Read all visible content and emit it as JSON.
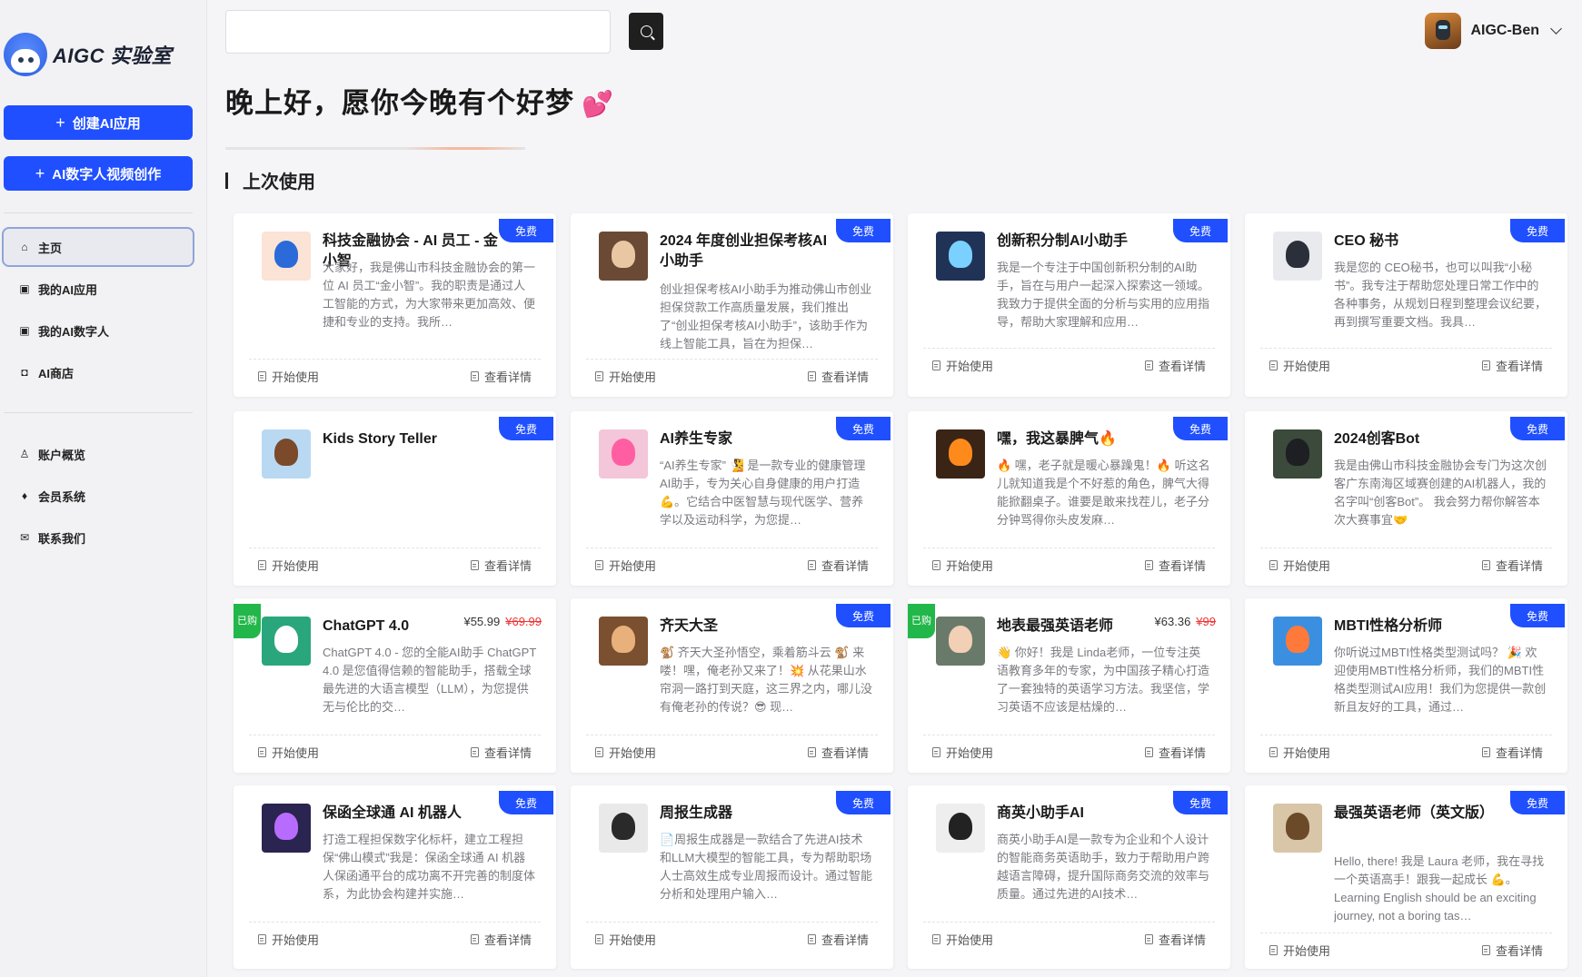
{
  "sidebar": {
    "logo_text": "AIGC 实验室",
    "create_app": "创建AI应用",
    "create_video": "AI数字人视频创作",
    "nav": [
      {
        "label": "主页",
        "icon": "home-icon"
      },
      {
        "label": "我的AI应用",
        "icon": "app-icon"
      },
      {
        "label": "我的AI数字人",
        "icon": "digital-human-icon"
      },
      {
        "label": "AI商店",
        "icon": "store-icon"
      }
    ],
    "nav2": [
      {
        "label": "账户概览",
        "icon": "user-icon"
      },
      {
        "label": "会员系统",
        "icon": "diamond-icon"
      },
      {
        "label": "联系我们",
        "icon": "mail-icon"
      }
    ]
  },
  "header": {
    "search_placeholder": "",
    "user_name": "AIGC-Ben"
  },
  "main": {
    "greeting": "晚上好，愿你今晚有个好梦",
    "greeting_emoji": "💕",
    "section_title": "上次使用"
  },
  "card_actions": {
    "start": "开始使用",
    "detail": "查看详情"
  },
  "cards": [
    {
      "title": "科技金融协会 - AI 员工 - 金小智",
      "badge": "免费",
      "desc": "大家好，我是佛山市科技金融协会的第一位 AI 员工“金小智”。我的职责是通过人工智能的方式，为大家带来更加高效、便捷和专业的支持。我所…"
    },
    {
      "title": "2024 年度创业担保考核AI小助手",
      "badge": "免费",
      "desc": "创业担保考核AI小助手为推动佛山市创业担保贷款工作高质量发展，我们推出了“创业担保考核AI小助手”，该助手作为线上智能工具，旨在为担保…"
    },
    {
      "title": "创新积分制AI小助手",
      "badge": "免费",
      "desc": "我是一个专注于中国创新积分制的AI助手，旨在与用户一起深入探索这一领域。我致力于提供全面的分析与实用的应用指导，帮助大家理解和应用…"
    },
    {
      "title": "CEO 秘书",
      "badge": "免费",
      "desc": "我是您的 CEO秘书，也可以叫我“小秘书”。我专注于帮助您处理日常工作中的各种事务，从规划日程到整理会议纪要，再到撰写重要文档。我具…"
    },
    {
      "title": "Kids Story Teller",
      "badge": "免费",
      "desc": ""
    },
    {
      "title": "AI养生专家",
      "badge": "免费",
      "desc": "“AI养生专家” 🧏 是一款专业的健康管理AI助手，专为关心自身健康的用户打造 💪。它结合中医智慧与现代医学、营养学以及运动科学，为您提…"
    },
    {
      "title": "嘿，我这暴脾气🔥",
      "badge": "免费",
      "desc": "🔥 嘿，老子就是暖心暴躁鬼！🔥 听这名儿就知道我是个不好惹的角色，脾气大得能掀翻桌子。谁要是敢来找茬儿，老子分分钟骂得你头皮发麻…"
    },
    {
      "title": "2024创客Bot",
      "badge": "免费",
      "desc": "我是由佛山市科技金融协会专门为这次创客广东南海区域赛创建的AI机器人，我的名字叫“创客Bot”。 我会努力帮你解答本次大赛事宜🤝"
    },
    {
      "title": "ChatGPT 4.0",
      "badge": "已购",
      "price": "¥55.99",
      "old_price": "¥69.99",
      "desc": "ChatGPT 4.0 - 您的全能AI助手 ChatGPT 4.0 是您值得信赖的智能助手，搭载全球最先进的大语言模型（LLM），为您提供无与伦比的交…"
    },
    {
      "title": "齐天大圣",
      "badge": "免费",
      "desc": "🐒 齐天大圣孙悟空，乘着筋斗云 🐒 来喽！嘿，俺老孙又来了！💥 从花果山水帘洞一路打到天庭，这三界之内，哪儿没有俺老孙的传说？😎 现…"
    },
    {
      "title": "地表最强英语老师",
      "badge": "已购",
      "price": "¥63.36",
      "old_price": "¥99",
      "desc": "👋 你好！我是 Linda老师，一位专注英语教育多年的专家，为中国孩子精心打造了一套独特的英语学习方法。我坚信，学习英语不应该是枯燥的…"
    },
    {
      "title": "MBTI性格分析师",
      "badge": "免费",
      "desc": "你听说过MBTI性格类型测试吗？ 🎉 欢迎使用MBTI性格分析师，我们的MBTI性格类型测试AI应用！我们为您提供一款创新且友好的工具，通过…"
    },
    {
      "title": "保函全球通 AI 机器人",
      "badge": "免费",
      "desc": "打造工程担保数字化标杆，建立工程担保“佛山模式”我是：保函全球通 AI 机器人保函通平台的成功离不开完善的制度体系，为此协会构建并实施…"
    },
    {
      "title": "周报生成器",
      "badge": "免费",
      "desc": "📄周报生成器是一款结合了先进AI技术和LLM大模型的智能工具，专为帮助职场人士高效生成专业周报而设计。通过智能分析和处理用户输入…"
    },
    {
      "title": "商英小助手AI",
      "badge": "免费",
      "desc": "商英小助手AI是一款专为企业和个人设计的智能商务英语助手，致力于帮助用户跨越语言障碍，提升国际商务交流的效率与质量。通过先进的AI技术…"
    },
    {
      "title": "最强英语老师（英文版）",
      "badge": "免费",
      "desc": "Hello, there! 我是 Laura 老师，我在寻找一个英语高手！跟我一起成长 💪。 Learning English should be an exciting journey, not a boring tas…"
    }
  ],
  "thumb_colors": [
    [
      "#fbe3d6",
      "#2a6ad9"
    ],
    [
      "#6a4a35",
      "#e9c7a3"
    ],
    [
      "#203356",
      "#7ad0ff"
    ],
    [
      "#e9eaee",
      "#2b2f3a"
    ],
    [
      "#b9d8f2",
      "#7a4a2a"
    ],
    [
      "#f3c6d9",
      "#ff5fa2"
    ],
    [
      "#3a2416",
      "#ff8a1c"
    ],
    [
      "#3b4a3a",
      "#1d1f22"
    ],
    [
      "#2aa67d",
      "#ffffff"
    ],
    [
      "#7a5030",
      "#e8b07a"
    ],
    [
      "#6a7a6a",
      "#f1d0b5"
    ],
    [
      "#3a8fe0",
      "#ff7a3a"
    ],
    [
      "#2a2450",
      "#b86bff"
    ],
    [
      "#e9e9e9",
      "#2a2a2a"
    ],
    [
      "#eeeeee",
      "#222222"
    ],
    [
      "#d9c6a8",
      "#6b4a2a"
    ]
  ]
}
